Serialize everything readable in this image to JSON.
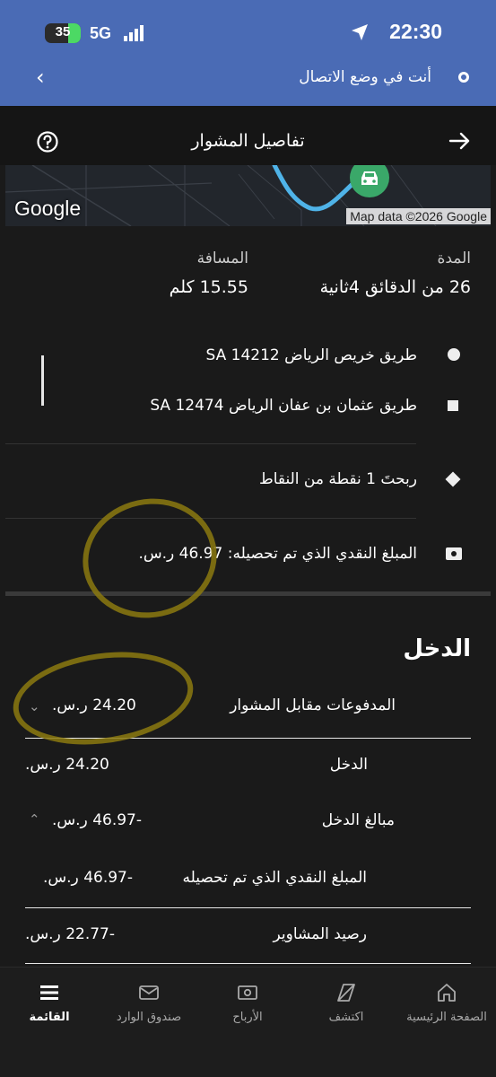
{
  "status_bar": {
    "time": "22:30",
    "battery": "35",
    "network": "5G"
  },
  "banner": {
    "text": "أنت في وضع الاتصال"
  },
  "header": {
    "title": "تفاصيل المشوار"
  },
  "map": {
    "logo": "Google",
    "attribution": "Map data ©2026 Google"
  },
  "stats": {
    "duration_label": "المدة",
    "duration_value": "26 من الدقائق 4ثانية",
    "distance_label": "المسافة",
    "distance_value": "15.55 كلم"
  },
  "route": {
    "pickup": "طريق خريص الرياض 14212 SA",
    "dropoff": "طريق عثمان بن عفان الرياض 12474 SA"
  },
  "points": {
    "text": "ربحتَ 1 نقطة من النقاط"
  },
  "cash": {
    "text": "المبلغ النقدي الذي تم تحصيله: 46.97 ر.س."
  },
  "income": {
    "title": "الدخل",
    "rows": [
      {
        "label": "المدفوعات مقابل المشوار",
        "value": "24.20 ر.س."
      },
      {
        "label": "الدخل",
        "value": "24.20 ر.س."
      },
      {
        "label": "مبالغ الدخل",
        "value": "-46.97 ر.س."
      },
      {
        "label": "المبلغ النقدي الذي تم تحصيله",
        "value": "-46.97 ر.س."
      },
      {
        "label": "رصيد المشاوير",
        "value": "-22.77 ر.س."
      }
    ]
  },
  "bottom_nav": {
    "items": [
      {
        "label": "الصفحة الرئيسية",
        "icon": "home-icon"
      },
      {
        "label": "اكتشف",
        "icon": "compass-icon"
      },
      {
        "label": "الأرباح",
        "icon": "earnings-icon"
      },
      {
        "label": "صندوق الوارد",
        "icon": "inbox-icon"
      },
      {
        "label": "القائمة",
        "icon": "menu-icon"
      }
    ]
  },
  "colors": {
    "banner": "#4a6bb5",
    "background": "#1a1a1a",
    "map_route": "#4fb3e8",
    "pin": "#3aa869",
    "annotation": "#8c7a10"
  }
}
